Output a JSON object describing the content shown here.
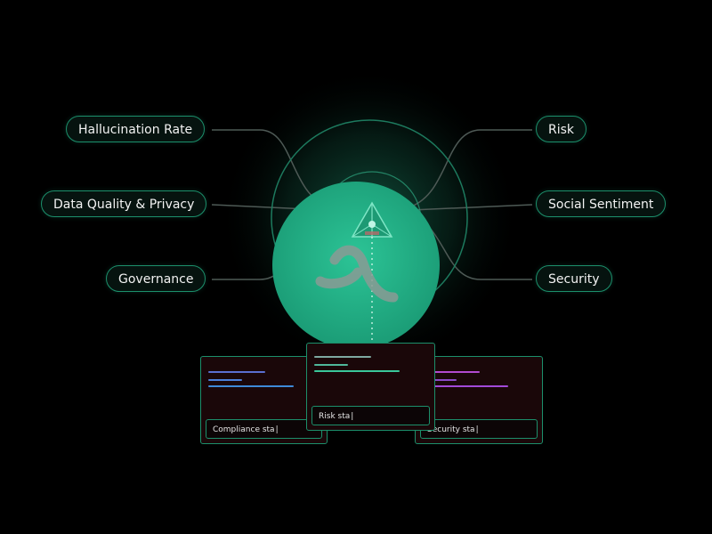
{
  "metrics_left": [
    {
      "id": "hallucination-rate",
      "label": "Hallucination Rate"
    },
    {
      "id": "data-quality-privacy",
      "label": "Data Quality & Privacy"
    },
    {
      "id": "governance",
      "label": "Governance"
    }
  ],
  "metrics_right": [
    {
      "id": "risk",
      "label": "Risk"
    },
    {
      "id": "social-sentiment",
      "label": "Social Sentiment"
    },
    {
      "id": "security",
      "label": "Security"
    }
  ],
  "cards": [
    {
      "id": "compliance",
      "input_text": "Compliance sta",
      "bar_colors": [
        "#5a6fd0",
        "#4a7fd8",
        "#3e8ad8"
      ]
    },
    {
      "id": "risk",
      "input_text": "Risk sta",
      "bar_colors": [
        "#7fa8a0",
        "#4fb79a",
        "#3ac79a"
      ]
    },
    {
      "id": "security",
      "input_text": "Security sta",
      "bar_colors": [
        "#b24ad0",
        "#8a4ac8",
        "#a24ad8"
      ]
    }
  ],
  "colors": {
    "background": "#000000",
    "accent": "#1fa57c",
    "orb": "#23b389",
    "border": "#1c8f6b",
    "logo": "#8a9b95"
  },
  "icons": {
    "center_logo": "lambda-logo-icon",
    "center_prism": "pyramid-prism-icon"
  }
}
